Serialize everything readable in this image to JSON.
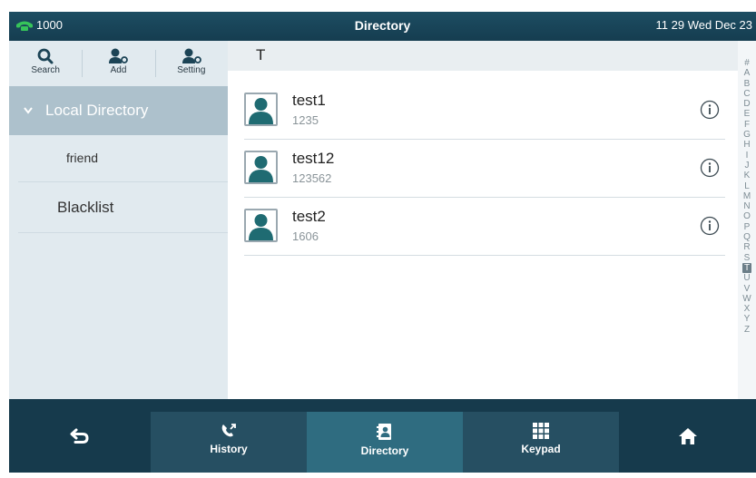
{
  "status": {
    "line": "1000",
    "title": "Directory",
    "datetime": "11 29 Wed Dec 23"
  },
  "toolbar": [
    {
      "label": "Search",
      "icon": "search-icon"
    },
    {
      "label": "Add",
      "icon": "add-user-icon"
    },
    {
      "label": "Setting",
      "icon": "user-setting-icon"
    }
  ],
  "sidebar": {
    "local_directory": "Local Directory",
    "group": "friend",
    "blacklist": "Blacklist"
  },
  "section_letter": "T",
  "contacts": [
    {
      "name": "test1",
      "number": "1235"
    },
    {
      "name": "test12",
      "number": "123562"
    },
    {
      "name": "test2",
      "number": "1606"
    }
  ],
  "alphabet": [
    "#",
    "A",
    "B",
    "C",
    "D",
    "E",
    "F",
    "G",
    "H",
    "I",
    "J",
    "K",
    "L",
    "M",
    "N",
    "O",
    "P",
    "Q",
    "R",
    "S",
    "T",
    "U",
    "V",
    "W",
    "X",
    "Y",
    "Z"
  ],
  "alphabet_active": "T",
  "bottom_nav": {
    "back_icon": "back-icon",
    "home_icon": "home-icon",
    "tabs": [
      {
        "label": "History",
        "icon": "history-icon"
      },
      {
        "label": "Directory",
        "icon": "directory-icon"
      },
      {
        "label": "Keypad",
        "icon": "keypad-icon"
      }
    ],
    "active_tab": "Directory"
  },
  "colors": {
    "header_bg": "#1d4d62",
    "selected_group_bg": "#adc1cc",
    "nav_bg": "#163a4c",
    "nav_active_bg": "#2f6c80",
    "line_icon_green": "#36c45a",
    "avatar_teal": "#1f6b72"
  }
}
